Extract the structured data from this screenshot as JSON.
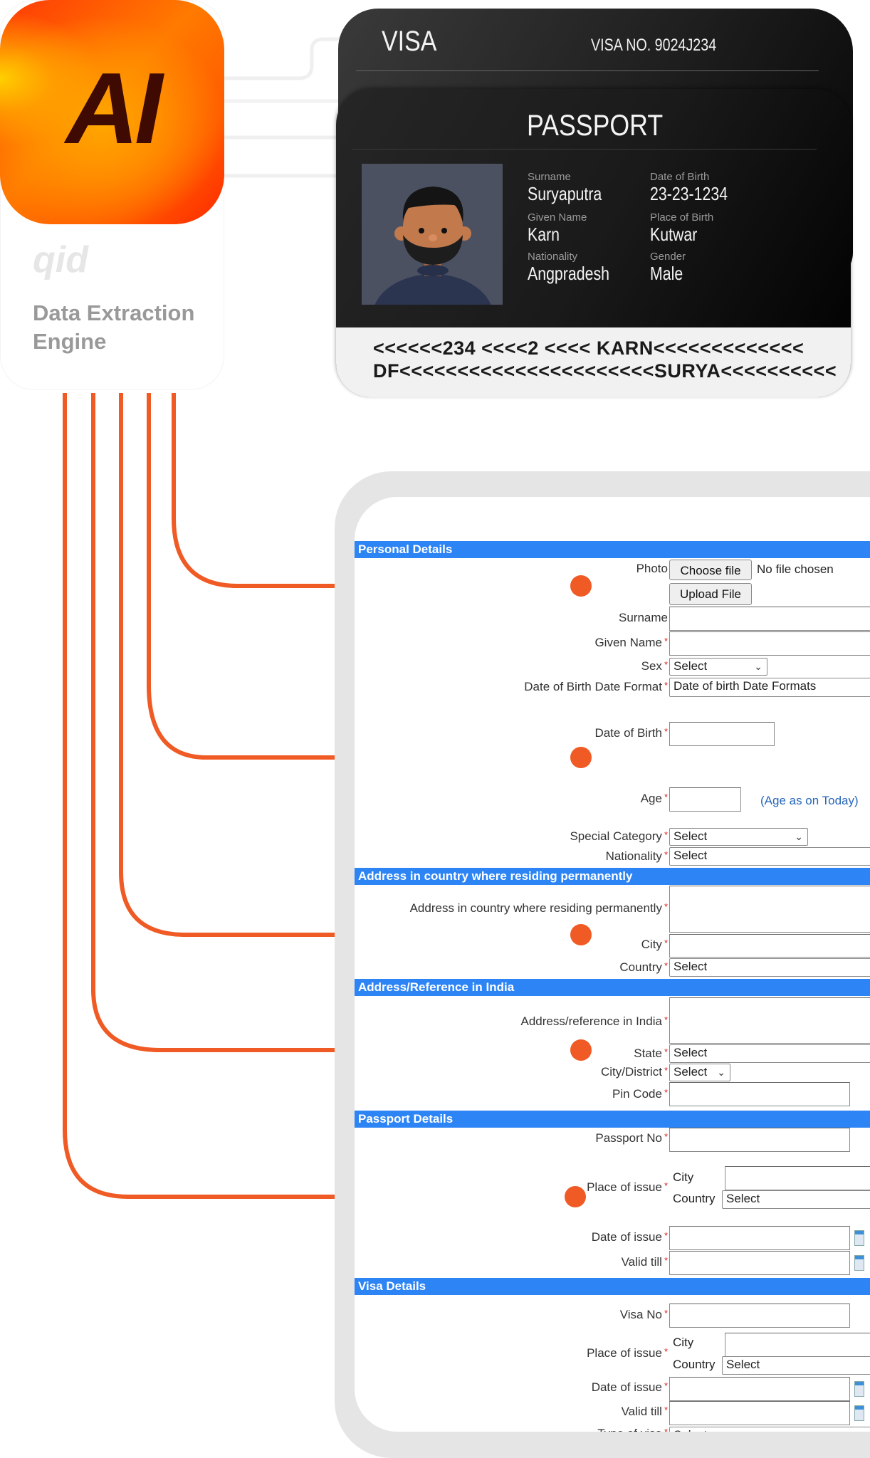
{
  "engine": {
    "logo_text": "AI",
    "brand_name": "qid",
    "subtitle": "Data Extraction Engine",
    "accent_color": "#f05a24"
  },
  "visa_card": {
    "title": "VISA",
    "visa_number": "VISA NO. 9024J234"
  },
  "passport_card": {
    "title": "PASSPORT",
    "photo_alt": "avatar-portrait",
    "fields": [
      {
        "label": "Surname",
        "value": "Suryaputra"
      },
      {
        "label": "Date of Birth",
        "value": "23-23-1234"
      },
      {
        "label": "Given Name",
        "value": "Karn"
      },
      {
        "label": "Place of Birth",
        "value": "Kutwar"
      },
      {
        "label": "Nationality",
        "value": "Angpradesh"
      },
      {
        "label": "Gender",
        "value": "Male"
      }
    ],
    "mrz_line1": "<<<<<<234 <<<<2 <<<< KARN<<<<<<<<<<<<<",
    "mrz_line2": "DF<<<<<<<<<<<<<<<<<<<<<<SURYA<<<<<<<<<<"
  },
  "form": {
    "section_color": "#2c84f5",
    "sections": {
      "personal": "Personal Details",
      "address_abroad": "Address in country where residing permanently",
      "address_india": "Address/Reference in India",
      "passport": "Passport Details",
      "visa": "Visa Details"
    },
    "personal": {
      "photo_label": "Photo",
      "choose_file": "Choose file",
      "no_file": "No file chosen",
      "upload_file": "Upload File",
      "surname_label": "Surname",
      "given_name_label": "Given Name",
      "sex_label": "Sex",
      "sex_value": "Select",
      "dob_format_label": "Date of Birth Date Format",
      "dob_format_value": "Date of birth Date Formats",
      "dob_label": "Date of Birth",
      "age_label": "Age",
      "age_hint": "(Age as on Today)",
      "special_category_label": "Special Category",
      "special_category_value": "Select",
      "nationality_label": "Nationality",
      "nationality_value": "Select"
    },
    "address_abroad": {
      "address_label": "Address in country where residing permanently",
      "city_label": "City",
      "country_label": "Country",
      "country_value": "Select"
    },
    "address_india": {
      "address_label": "Address/reference in India",
      "state_label": "State",
      "state_value": "Select",
      "district_label": "City/District",
      "district_value": "Select",
      "pin_label": "Pin Code"
    },
    "passport": {
      "number_label": "Passport No",
      "place_label": "Place of issue",
      "city_label": "City",
      "country_label": "Country",
      "country_value": "Select",
      "date_issue_label": "Date of issue",
      "valid_till_label": "Valid till"
    },
    "visa": {
      "number_label": "Visa No",
      "place_label": "Place of issue",
      "city_label": "City",
      "country_label": "Country",
      "country_value": "Select",
      "date_issue_label": "Date of issue",
      "valid_till_label": "Valid till",
      "type_label": "Type of visa",
      "type_value": "Select"
    },
    "required_marker": "*"
  }
}
